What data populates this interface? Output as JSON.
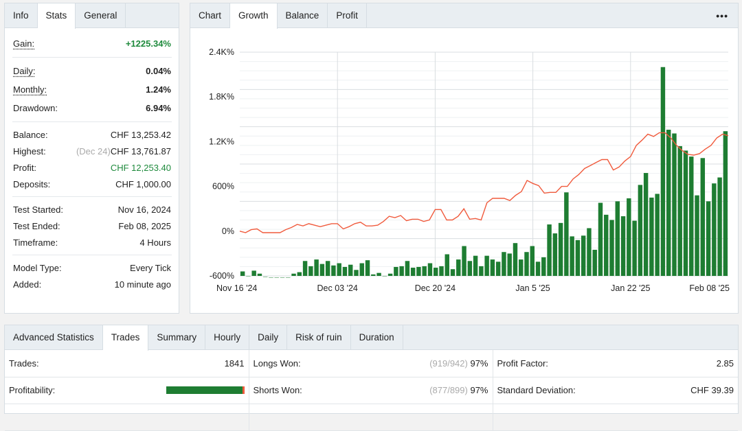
{
  "left_panel": {
    "tabs": [
      "Info",
      "Stats",
      "General"
    ],
    "active_tab": "Stats",
    "gain": {
      "label": "Gain:",
      "value": "+1225.34%"
    },
    "daily": {
      "label": "Daily:",
      "value": "0.04%"
    },
    "monthly": {
      "label": "Monthly:",
      "value": "1.24%"
    },
    "drawdown": {
      "label": "Drawdown:",
      "value": "6.94%"
    },
    "balance": {
      "label": "Balance:",
      "value": "CHF 13,253.42"
    },
    "highest": {
      "label": "Highest:",
      "note": "(Dec 24)",
      "value": "CHF 13,761.87"
    },
    "profit": {
      "label": "Profit:",
      "value": "CHF 12,253.40"
    },
    "deposits": {
      "label": "Deposits:",
      "value": "CHF 1,000.00"
    },
    "test_started": {
      "label": "Test Started:",
      "value": "Nov 16, 2024"
    },
    "test_ended": {
      "label": "Test Ended:",
      "value": "Feb 08, 2025"
    },
    "timeframe": {
      "label": "Timeframe:",
      "value": "4 Hours"
    },
    "model_type": {
      "label": "Model Type:",
      "value": "Every Tick"
    },
    "added": {
      "label": "Added:",
      "value": "10 minute ago"
    }
  },
  "chart_panel": {
    "tabs": [
      "Chart",
      "Growth",
      "Balance",
      "Profit"
    ],
    "active_tab": "Growth",
    "menu": "•••"
  },
  "chart_data": {
    "type": "bar",
    "x_tick_labels": [
      "Nov 16 '24",
      "Dec 03 '24",
      "Dec 20 '24",
      "Jan 5 '25",
      "Jan 22 '25",
      "Feb 08 '25"
    ],
    "y_tick_labels": [
      "2.4K%",
      "1.8K%",
      "1.2K%",
      "600%",
      "0%",
      "-600%"
    ],
    "y_ticks": [
      2400,
      1800,
      1200,
      600,
      0,
      -600
    ],
    "ylim": [
      -600,
      2400
    ],
    "grid": true,
    "colors": {
      "bars": "#1e7d32",
      "line": "#f05a3c"
    },
    "bar_values": [
      -540,
      -600,
      -530,
      -570,
      -610,
      -620,
      -620,
      -620,
      -620,
      -570,
      -550,
      -400,
      -470,
      -380,
      -440,
      -400,
      -460,
      -430,
      -480,
      -450,
      -520,
      -430,
      -390,
      -580,
      -560,
      -600,
      -570,
      -480,
      -470,
      -400,
      -490,
      -480,
      -470,
      -430,
      -490,
      -470,
      -310,
      -510,
      -380,
      -200,
      -400,
      -330,
      -470,
      -330,
      -380,
      -410,
      -280,
      -300,
      -160,
      -380,
      -280,
      -200,
      -410,
      -350,
      90,
      -30,
      110,
      520,
      -70,
      -120,
      -60,
      40,
      -250,
      380,
      220,
      150,
      400,
      200,
      440,
      140,
      620,
      780,
      450,
      500,
      2200,
      1360,
      1310,
      1140,
      1080,
      1000,
      480,
      980,
      400,
      640,
      720,
      1340
    ],
    "line_values": [
      0,
      -20,
      20,
      30,
      -20,
      -20,
      -20,
      -20,
      20,
      50,
      90,
      70,
      100,
      80,
      60,
      80,
      100,
      100,
      30,
      60,
      100,
      120,
      70,
      70,
      80,
      130,
      200,
      180,
      210,
      140,
      160,
      160,
      130,
      150,
      290,
      290,
      150,
      150,
      200,
      300,
      160,
      170,
      150,
      380,
      440,
      440,
      440,
      410,
      480,
      530,
      680,
      640,
      610,
      510,
      520,
      520,
      600,
      600,
      700,
      760,
      840,
      880,
      920,
      960,
      960,
      820,
      860,
      940,
      1000,
      1150,
      1220,
      1300,
      1270,
      1320,
      1320,
      1250,
      1150,
      1080,
      1030,
      1020,
      1040,
      1100,
      1150,
      1250,
      1300,
      1280
    ]
  },
  "bottom_panel": {
    "tabs": [
      "Advanced Statistics",
      "Trades",
      "Summary",
      "Hourly",
      "Daily",
      "Risk of ruin",
      "Duration"
    ],
    "active_tab": "Trades",
    "trades": {
      "label": "Trades:",
      "value": "1841"
    },
    "profitability": {
      "label": "Profitability:",
      "value_fraction": 0.98
    },
    "longs_won": {
      "label": "Longs Won:",
      "note": "(919/942)",
      "value": "97%"
    },
    "shorts_won": {
      "label": "Shorts Won:",
      "note": "(877/899)",
      "value": "97%"
    },
    "profit_factor": {
      "label": "Profit Factor:",
      "value": "2.85"
    },
    "std_dev": {
      "label": "Standard Deviation:",
      "value": "CHF 39.39"
    }
  }
}
